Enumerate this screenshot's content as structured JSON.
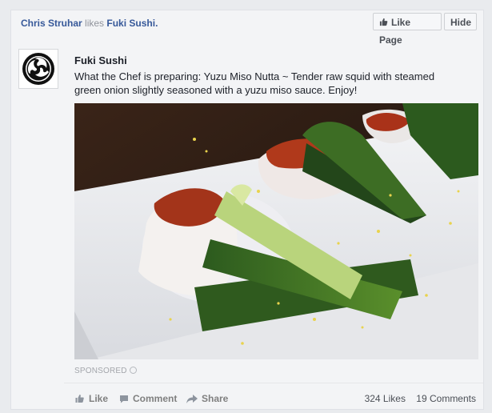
{
  "header": {
    "liker": "Chris Struhar",
    "verb": "likes",
    "page": "Fuki Sushi."
  },
  "buttons": {
    "like_page": "Like Page",
    "hide": "Hide"
  },
  "post": {
    "page_name": "Fuki Sushi",
    "text": "What the Chef is preparing: Yuzu Miso Nutta ~ Tender raw squid with steamed green onion slightly seasoned with a yuzu miso sauce. Enjoy!",
    "sponsored": "SPONSORED"
  },
  "actions": {
    "like": "Like",
    "comment": "Comment",
    "share": "Share"
  },
  "stats": {
    "likes": "324 Likes",
    "comments": "19 Comments"
  },
  "icons": {
    "avatar": "mitsudomoe-logo",
    "thumb": "thumbs-up-icon",
    "comment": "speech-bubble-icon",
    "share": "arrow-share-icon",
    "globe": "globe-icon"
  },
  "colors": {
    "link": "#365899",
    "text": "#1d2129",
    "muted": "#90949c"
  }
}
